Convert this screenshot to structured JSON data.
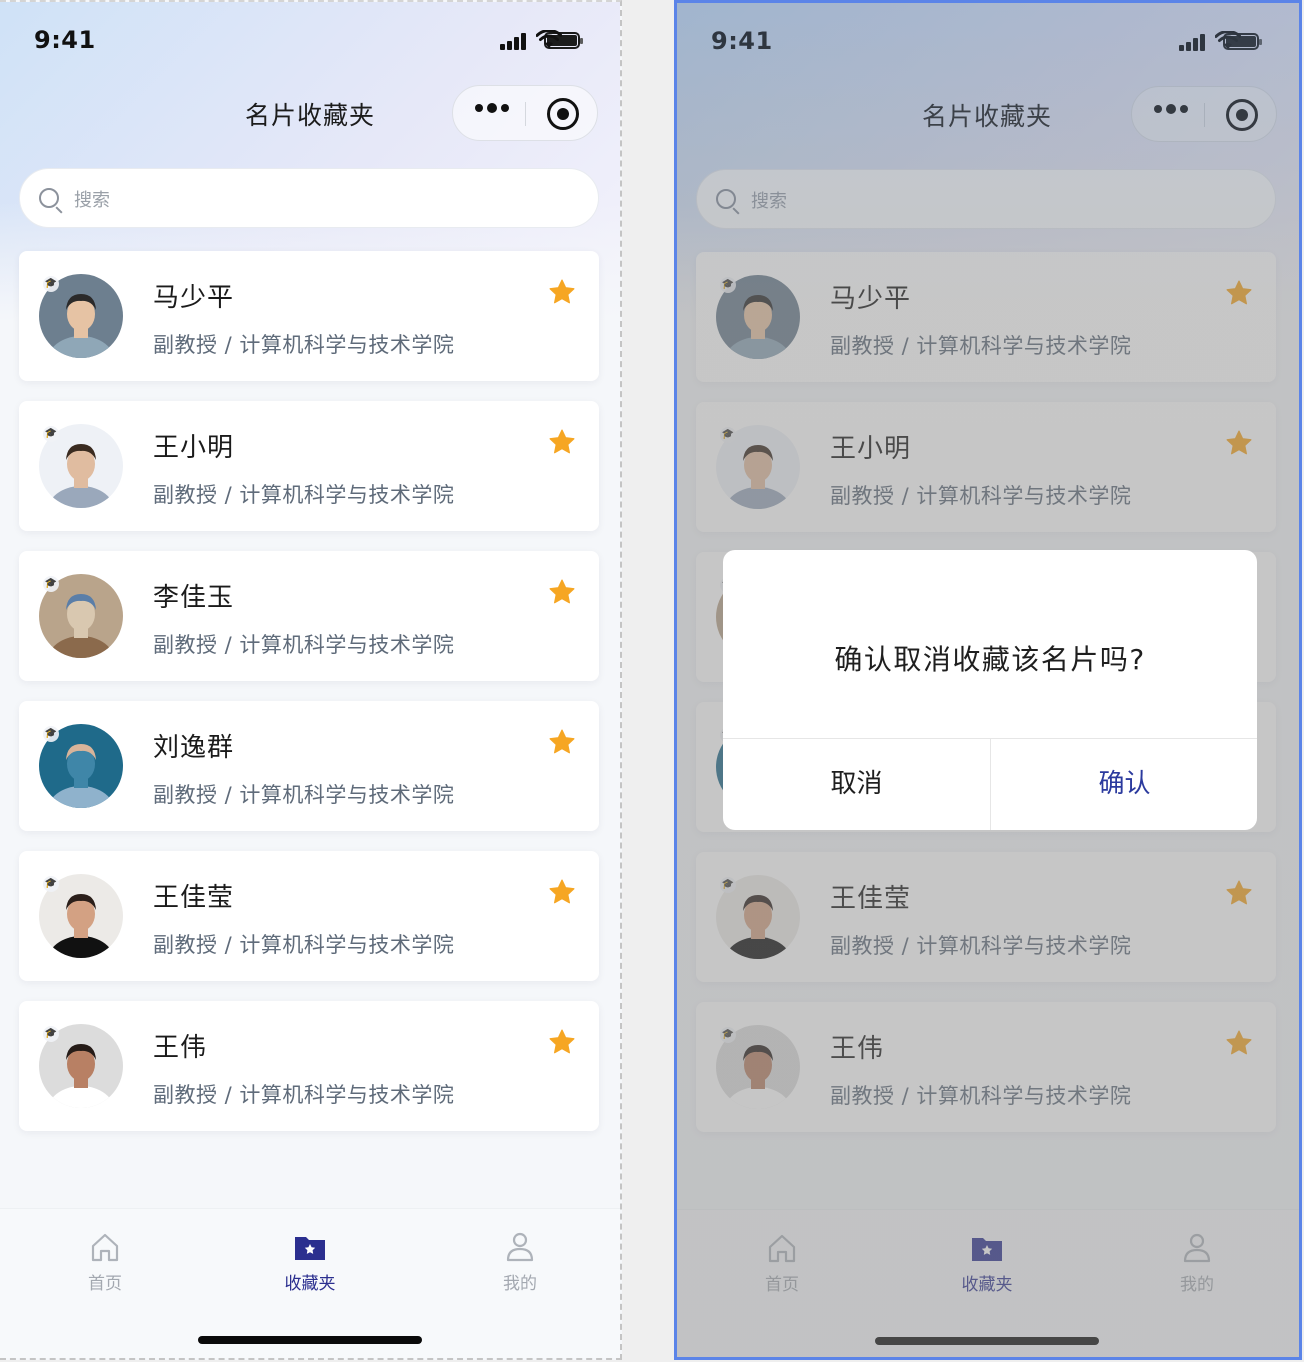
{
  "status": {
    "time": "9:41"
  },
  "header": {
    "title": "名片收藏夹"
  },
  "search": {
    "placeholder": "搜索"
  },
  "cards": [
    {
      "name": "马少平",
      "role": "副教授 / 计算机科学与技术学院",
      "colors": [
        "#6d7f8f",
        "#e6c3a4",
        "#2b2a2a",
        "#8fa7b7"
      ]
    },
    {
      "name": "王小明",
      "role": "副教授 / 计算机科学与技术学院",
      "colors": [
        "#eef1f6",
        "#e0bca0",
        "#3a2b20",
        "#9aa8bb"
      ]
    },
    {
      "name": "李佳玉",
      "role": "副教授 / 计算机科学与技术学院",
      "colors": [
        "#b9a48b",
        "#d9c8b0",
        "#5a7ea8",
        "#8b6a4c"
      ]
    },
    {
      "name": "刘逸群",
      "role": "副教授 / 计算机科学与技术学院",
      "colors": [
        "#1f6a8a",
        "#3f86a8",
        "#d8b49a",
        "#8fb2cc"
      ]
    },
    {
      "name": "王佳莹",
      "role": "副教授 / 计算机科学与技术学院",
      "colors": [
        "#eceae7",
        "#d3a183",
        "#2b1f1a",
        "#111111"
      ]
    },
    {
      "name": "王伟",
      "role": "副教授 / 计算机科学与技术学院",
      "colors": [
        "#dcdcdc",
        "#b88064",
        "#261c18",
        "#ffffff"
      ]
    }
  ],
  "tabs": [
    {
      "label": "首页",
      "icon": "home-icon",
      "active": false
    },
    {
      "label": "收藏夹",
      "icon": "favorites-folder-icon",
      "active": true
    },
    {
      "label": "我的",
      "icon": "user-icon",
      "active": false
    }
  ],
  "dialog": {
    "message": "确认取消收藏该名片吗?",
    "cancel_label": "取消",
    "confirm_label": "确认"
  },
  "colors": {
    "star": "#f6a623",
    "accent": "#2b2f8f",
    "confirm": "#2b3a9e"
  }
}
